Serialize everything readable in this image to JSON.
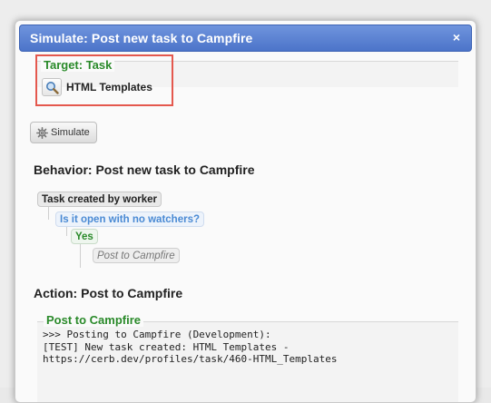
{
  "dialog": {
    "title": "Simulate: Post new task to Campfire",
    "close_symbol": "×"
  },
  "target": {
    "legend": "Target: Task",
    "value": "HTML Templates",
    "search_icon": "magnifier-icon"
  },
  "simulate_button": {
    "label": "Simulate",
    "icon": "gear-icon"
  },
  "behavior": {
    "heading": "Behavior: Post new task to Campfire",
    "tree": {
      "trigger": "Task created by worker",
      "switch": "Is it open with no watchers?",
      "outcome": "Yes",
      "action": "Post to Campfire"
    }
  },
  "action_section": {
    "heading": "Action: Post to Campfire",
    "result_legend": "Post to Campfire",
    "output_lines": [
      ">>> Posting to Campfire (Development):",
      "[TEST] New task created: HTML Templates -",
      "https://cerb.dev/profiles/task/460-HTML_Templates"
    ]
  },
  "colors": {
    "titlebar": "#5a7fd0",
    "legend_green": "#2a8a2a",
    "switch_blue": "#4a8ad4",
    "highlight_red": "#e4584e"
  }
}
